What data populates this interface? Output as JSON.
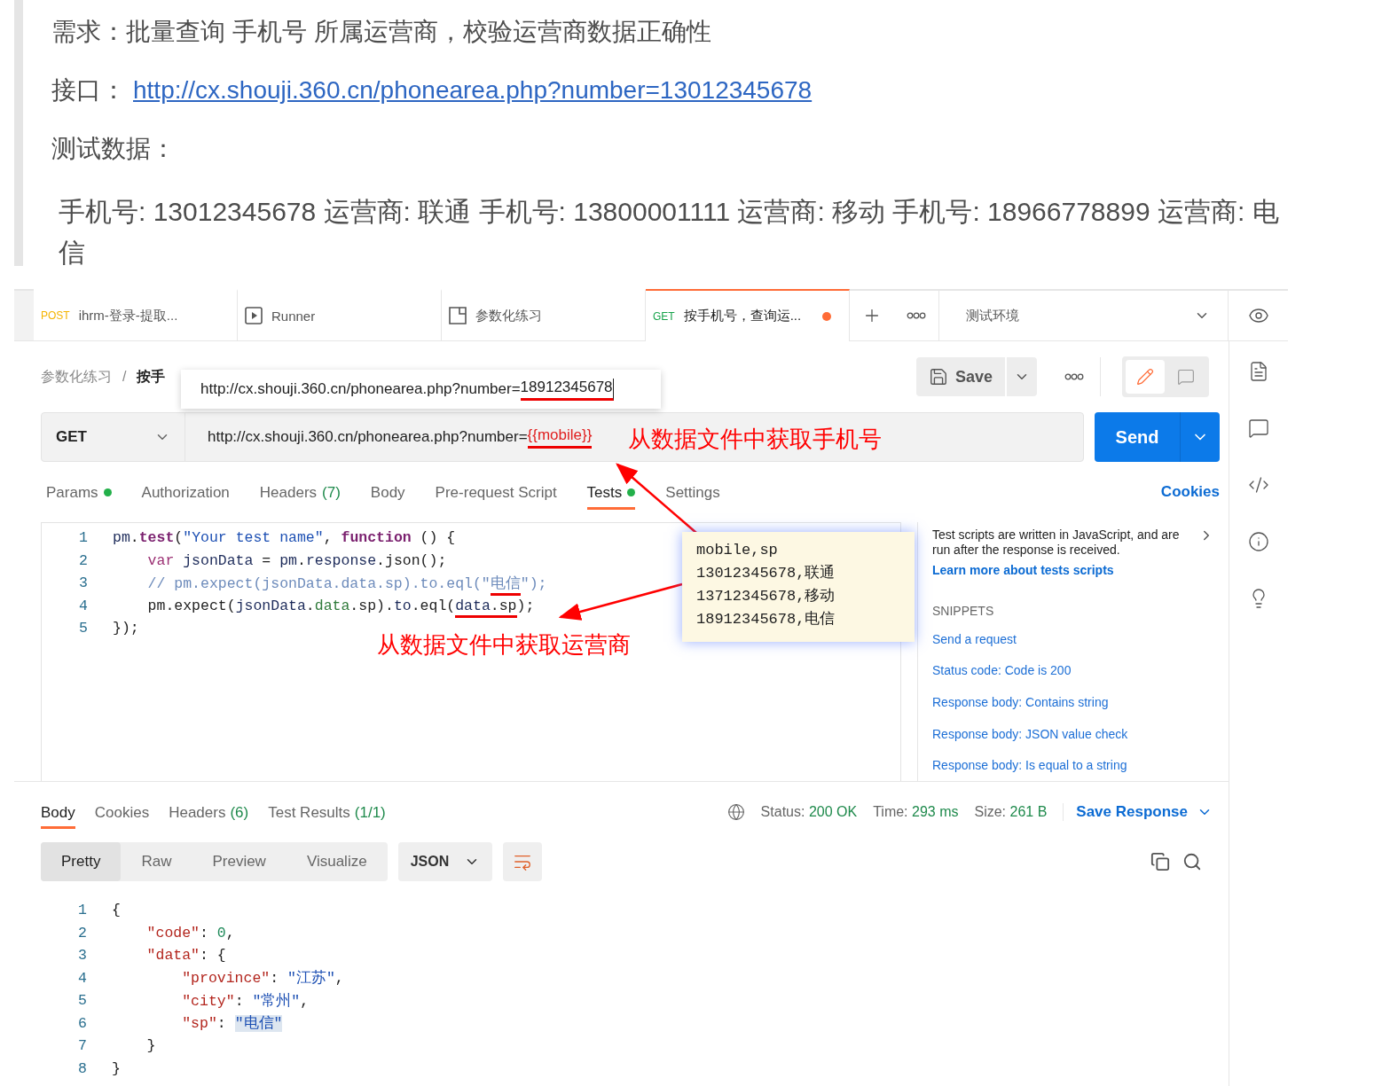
{
  "article": {
    "requirement": "需求：批量查询 手机号 所属运营商，校验运营商数据正确性",
    "api_label": "接口：",
    "api_link": "http://cx.shouji.360.cn/phonearea.php?number=13012345678",
    "test_data_label": "测试数据：",
    "test_data": "手机号: 13012345678 运营商: 联通  手机号: 13800001111 运营商: 移动  手机号: 18966778899 运营商: 电信"
  },
  "tabs": [
    {
      "kind": "request",
      "method": "POST",
      "title": "ihrm-登录-提取...",
      "selected": false,
      "unsaved": false
    },
    {
      "kind": "runner",
      "title": "Runner",
      "selected": false,
      "unsaved": false
    },
    {
      "kind": "collection",
      "title": "参数化练习",
      "selected": false,
      "unsaved": false
    },
    {
      "kind": "request",
      "method": "GET",
      "title": "按手机号，查询运...",
      "selected": true,
      "unsaved": true
    }
  ],
  "environment": "测试环境",
  "breadcrumb": [
    "参数化练习",
    "按手"
  ],
  "breadcrumb_separator": "/",
  "save_label": "Save",
  "url_popup": {
    "base": "http://cx.shouji.360.cn/phonearea.php?number=",
    "number": "18912345678"
  },
  "request": {
    "method": "GET",
    "url": "http://cx.shouji.360.cn/phonearea.php?number=",
    "url_var": "{{mobile}}",
    "send": "Send"
  },
  "annotations": {
    "mobile": "从数据文件中获取手机号",
    "sp": "从数据文件中获取运营商"
  },
  "request_tabs": [
    {
      "label": "Params",
      "dot": true,
      "selected": false
    },
    {
      "label": "Authorization",
      "dot": false,
      "selected": false
    },
    {
      "label": "Headers",
      "count": "(7)",
      "dot": false,
      "selected": false
    },
    {
      "label": "Body",
      "dot": false,
      "selected": false
    },
    {
      "label": "Pre-request Script",
      "dot": false,
      "selected": false
    },
    {
      "label": "Tests",
      "dot": true,
      "selected": true
    },
    {
      "label": "Settings",
      "dot": false,
      "selected": false
    }
  ],
  "cookies": "Cookies",
  "test_code": [
    {
      "n": "1",
      "tokens": [
        {
          "kind": "plain",
          "text": "pm"
        },
        {
          "kind": "punc",
          "text": "."
        },
        {
          "kind": "fn",
          "text": "test"
        },
        {
          "kind": "punc",
          "text": "("
        },
        {
          "kind": "str",
          "text": "\"Your test name\""
        },
        {
          "kind": "punc",
          "text": ", "
        },
        {
          "kind": "fn",
          "text": "function"
        },
        {
          "kind": "punc",
          "text": " () {"
        }
      ]
    },
    {
      "n": "2",
      "tokens": [
        {
          "kind": "kw",
          "text": "    var"
        },
        {
          "kind": "plain",
          "text": " jsonData "
        },
        {
          "kind": "punc",
          "text": "= "
        },
        {
          "kind": "plain",
          "text": "pm"
        },
        {
          "kind": "punc",
          "text": "."
        },
        {
          "kind": "plain",
          "text": "response"
        },
        {
          "kind": "punc",
          "text": ".json();"
        }
      ]
    },
    {
      "n": "3",
      "tokens": [
        {
          "kind": "cm",
          "text": "    // pm.expect(jsonData.data.sp).to.eql(\""
        },
        {
          "kind": "cm",
          "text": "电信",
          "mark": true
        },
        {
          "kind": "cm",
          "text": "\");"
        }
      ]
    },
    {
      "n": "4",
      "tokens": [
        {
          "kind": "punc",
          "text": "    pm.expect("
        },
        {
          "kind": "plain",
          "text": "jsonData"
        },
        {
          "kind": "punc",
          "text": "."
        },
        {
          "kind": "prop",
          "text": "data"
        },
        {
          "kind": "punc",
          "text": ".sp)."
        },
        {
          "kind": "plain",
          "text": "to"
        },
        {
          "kind": "punc",
          "text": ".eql("
        },
        {
          "kind": "plain",
          "text": "data",
          "mark": true
        },
        {
          "kind": "punc",
          "text": ".sp",
          "mark": true
        },
        {
          "kind": "punc",
          "text": ");"
        }
      ]
    },
    {
      "n": "5",
      "tokens": [
        {
          "kind": "punc",
          "text": "});"
        }
      ]
    }
  ],
  "data_file": [
    "mobile,sp",
    "13012345678,联通",
    "13712345678,移动",
    "18912345678,电信"
  ],
  "help": {
    "text": "Test scripts are written in JavaScript, and are run after the response is received.",
    "link": "Learn more about tests scripts",
    "snippets_title": "SNIPPETS",
    "snippets": [
      "Send a request",
      "Status code: Code is 200",
      "Response body: Contains string",
      "Response body: JSON value check",
      "Response body: Is equal to a string"
    ]
  },
  "response": {
    "tabs": [
      {
        "label": "Body",
        "selected": true
      },
      {
        "label": "Cookies",
        "selected": false
      },
      {
        "label": "Headers",
        "count": "(6)",
        "selected": false
      },
      {
        "label": "Test Results",
        "count": "(1/1)",
        "selected": false
      }
    ],
    "stats": [
      {
        "label": "Status:",
        "value": "200 OK"
      },
      {
        "label": "Time:",
        "value": "293 ms"
      },
      {
        "label": "Size:",
        "value": "261 B"
      }
    ],
    "save": "Save Response",
    "views": [
      {
        "label": "Pretty",
        "selected": true
      },
      {
        "label": "Raw",
        "selected": false
      },
      {
        "label": "Preview",
        "selected": false
      },
      {
        "label": "Visualize",
        "selected": false
      }
    ],
    "format": "JSON",
    "code": [
      {
        "n": "1",
        "tokens": [
          {
            "kind": "punc",
            "text": "{"
          }
        ]
      },
      {
        "n": "2",
        "tokens": [
          {
            "kind": "key",
            "text": "    \"code\""
          },
          {
            "kind": "punc",
            "text": ": "
          },
          {
            "kind": "num",
            "text": "0"
          },
          {
            "kind": "punc",
            "text": ","
          }
        ]
      },
      {
        "n": "3",
        "tokens": [
          {
            "kind": "key",
            "text": "    \"data\""
          },
          {
            "kind": "punc",
            "text": ": {"
          }
        ]
      },
      {
        "n": "4",
        "tokens": [
          {
            "kind": "key",
            "text": "        \"province\""
          },
          {
            "kind": "punc",
            "text": ": "
          },
          {
            "kind": "str",
            "text": "\"江苏\""
          },
          {
            "kind": "punc",
            "text": ","
          }
        ]
      },
      {
        "n": "5",
        "tokens": [
          {
            "kind": "key",
            "text": "        \"city\""
          },
          {
            "kind": "punc",
            "text": ": "
          },
          {
            "kind": "str",
            "text": "\"常州\""
          },
          {
            "kind": "punc",
            "text": ","
          }
        ]
      },
      {
        "n": "6",
        "tokens": [
          {
            "kind": "key",
            "text": "        \"sp\""
          },
          {
            "kind": "punc",
            "text": ": "
          },
          {
            "kind": "str",
            "text": "\"电信\"",
            "hl": true
          }
        ]
      },
      {
        "n": "7",
        "tokens": [
          {
            "kind": "punc",
            "text": "    }"
          }
        ]
      },
      {
        "n": "8",
        "tokens": [
          {
            "kind": "punc",
            "text": "}"
          }
        ]
      }
    ]
  }
}
